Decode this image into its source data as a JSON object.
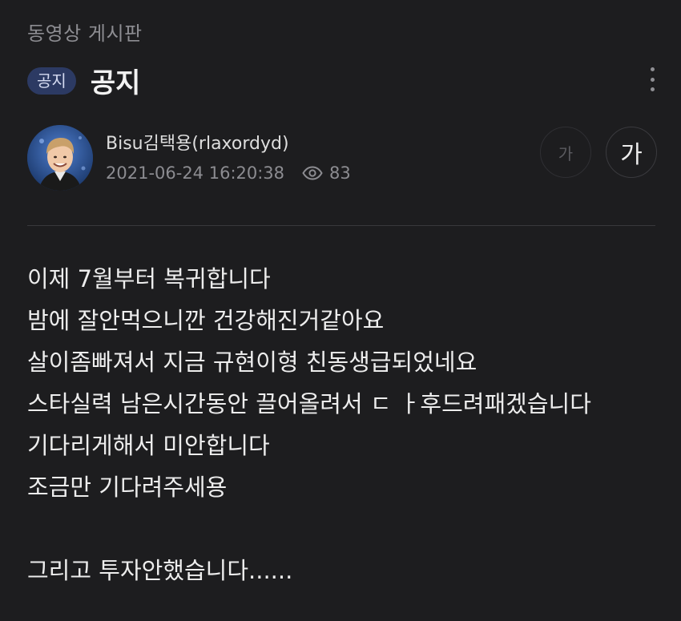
{
  "board": {
    "name": "동영상 게시판"
  },
  "post": {
    "badge": "공지",
    "title": "공지",
    "author": "Bisu김택용(rlaxordyd)",
    "datetime": "2021-06-24 16:20:38",
    "views": "83",
    "body_lines": [
      "이제 7월부터 복귀합니다",
      "밤에 잘안먹으니깐 건강해진거같아요",
      "살이좀빠져서 지금 규현이형 친동생급되었네요",
      "스타실력 남은시간동안 끌어올려서 ㄷ ㅏ후드려패겠습니다",
      "기다리게해서 미안합니다",
      "조금만 기다려주세용",
      "",
      "그리고 투자안했습니다......"
    ]
  },
  "font_controls": {
    "small_label": "가",
    "large_label": "가"
  },
  "icons": {
    "more": "more-vertical-icon",
    "views": "eye-icon"
  },
  "colors": {
    "background": "#1d1d1f",
    "badge_bg": "#2c3a63",
    "text_primary": "#ececec",
    "text_muted": "#8c8c91"
  }
}
